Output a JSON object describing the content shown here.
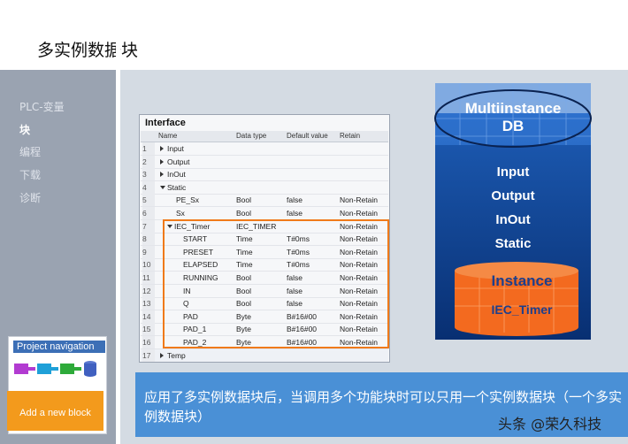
{
  "page_title": "多实例数据块",
  "sidebar": {
    "items": [
      {
        "label": "PLC-变量"
      },
      {
        "label": "块"
      },
      {
        "label": "编程"
      },
      {
        "label": "下载"
      },
      {
        "label": "诊断"
      }
    ]
  },
  "project_nav": {
    "title": "Project navigation",
    "button": "Add a new block"
  },
  "interface": {
    "title": "Interface",
    "headers": [
      "Name",
      "Data type",
      "Default value",
      "Retain"
    ],
    "rows": [
      {
        "num": "1",
        "name": "Input",
        "type": "",
        "default": "",
        "retain": ""
      },
      {
        "num": "2",
        "name": "Output",
        "type": "",
        "default": "",
        "retain": ""
      },
      {
        "num": "3",
        "name": "InOut",
        "type": "",
        "default": "",
        "retain": ""
      },
      {
        "num": "4",
        "name": "Static",
        "type": "",
        "default": "",
        "retain": ""
      },
      {
        "num": "5",
        "name": "PE_Sx",
        "type": "Bool",
        "default": "false",
        "retain": "Non-Retain"
      },
      {
        "num": "6",
        "name": "Sx",
        "type": "Bool",
        "default": "false",
        "retain": "Non-Retain"
      },
      {
        "num": "7",
        "name": "IEC_Timer",
        "type": "IEC_TIMER",
        "default": "",
        "retain": "Non-Retain"
      },
      {
        "num": "8",
        "name": "START",
        "type": "Time",
        "default": "T#0ms",
        "retain": "Non-Retain"
      },
      {
        "num": "9",
        "name": "PRESET",
        "type": "Time",
        "default": "T#0ms",
        "retain": "Non-Retain"
      },
      {
        "num": "10",
        "name": "ELAPSED",
        "type": "Time",
        "default": "T#0ms",
        "retain": "Non-Retain"
      },
      {
        "num": "11",
        "name": "RUNNING",
        "type": "Bool",
        "default": "false",
        "retain": "Non-Retain"
      },
      {
        "num": "12",
        "name": "IN",
        "type": "Bool",
        "default": "false",
        "retain": "Non-Retain"
      },
      {
        "num": "13",
        "name": "Q",
        "type": "Bool",
        "default": "false",
        "retain": "Non-Retain"
      },
      {
        "num": "14",
        "name": "PAD",
        "type": "Byte",
        "default": "B#16#00",
        "retain": "Non-Retain"
      },
      {
        "num": "15",
        "name": "PAD_1",
        "type": "Byte",
        "default": "B#16#00",
        "retain": "Non-Retain"
      },
      {
        "num": "16",
        "name": "PAD_2",
        "type": "Byte",
        "default": "B#16#00",
        "retain": "Non-Retain"
      },
      {
        "num": "17",
        "name": "Temp",
        "type": "",
        "default": "",
        "retain": ""
      }
    ]
  },
  "db_diagram": {
    "title_line1": "Multiinstance",
    "title_line2": "DB",
    "sections": [
      "Input",
      "Output",
      "InOut",
      "Static"
    ],
    "instance_title": "Instance",
    "instance_sub": "IEC_Timer"
  },
  "caption": "应用了多实例数据块后，当调用多个功能块时可以只用一个实例数据块（一个多实例数据块）",
  "watermark": "头条 @荣久科技",
  "colors": {
    "accent": "#f07a1a",
    "sidebar": "#9aa3b1",
    "cylinder": "#0c3f8c",
    "caption": "#4a90d6"
  }
}
